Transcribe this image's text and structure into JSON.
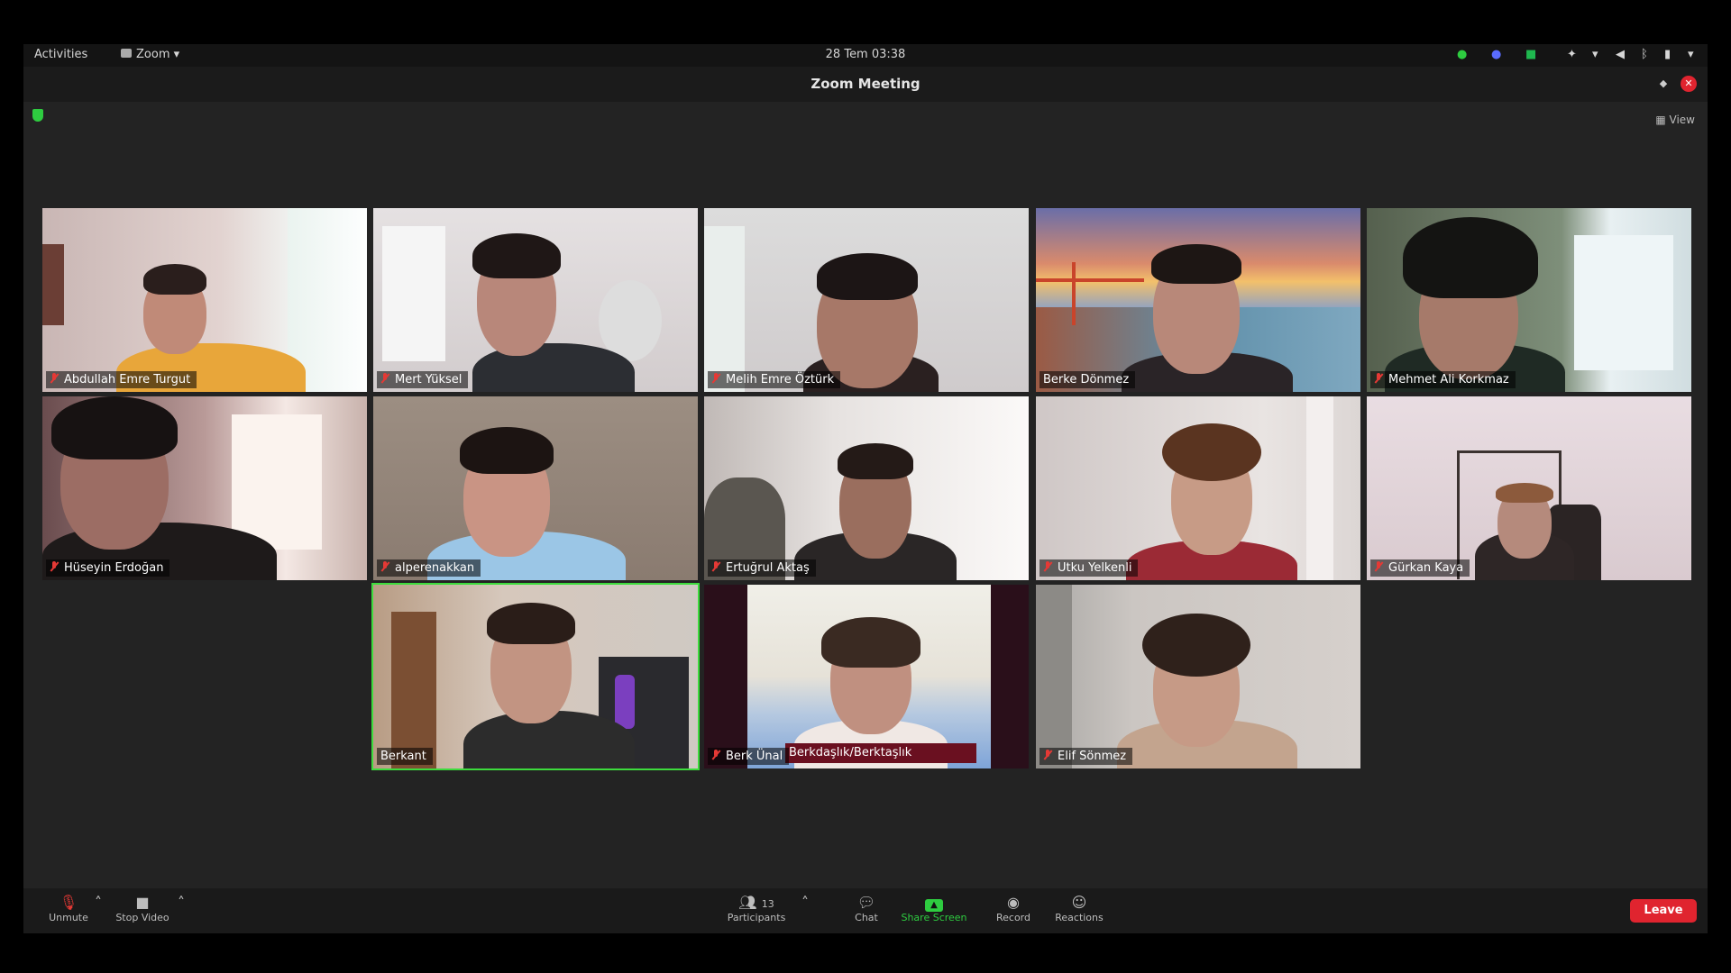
{
  "system_bar": {
    "activities": "Activities",
    "app_menu": "Zoom",
    "datetime": "28 Tem  03:38"
  },
  "window": {
    "title": "Zoom Meeting",
    "view_label": "View"
  },
  "participants": [
    {
      "name": "Abdullah Emre Turgut",
      "muted": true
    },
    {
      "name": "Mert Yüksel",
      "muted": true
    },
    {
      "name": "Melih Emre Öztürk",
      "muted": true
    },
    {
      "name": "Berke Dönmez",
      "muted": false
    },
    {
      "name": "Mehmet Ali Korkmaz",
      "muted": true
    },
    {
      "name": "Hüseyin Erdoğan",
      "muted": true
    },
    {
      "name": "alperenakkan",
      "muted": true
    },
    {
      "name": "Ertuğrul Aktaş",
      "muted": true
    },
    {
      "name": "Utku Yelkenli",
      "muted": true
    },
    {
      "name": "Gürkan Kaya",
      "muted": true
    },
    {
      "name": "Berkant",
      "muted": false,
      "active_speaker": true
    },
    {
      "name": "Berk Ünal",
      "muted": true,
      "overlay_text": "Berkdaşlık/Berktaşlık"
    },
    {
      "name": "Elif Sönmez",
      "muted": true
    }
  ],
  "toolbar": {
    "unmute": "Unmute",
    "stop_video": "Stop Video",
    "participants": "Participants",
    "participants_count": "13",
    "chat": "Chat",
    "share_screen": "Share Screen",
    "record": "Record",
    "reactions": "Reactions",
    "leave": "Leave"
  },
  "colors": {
    "leave": "#e0242f",
    "share": "#2ecc40",
    "active_border": "#3ddc3d",
    "muted_icon": "#e53935"
  }
}
